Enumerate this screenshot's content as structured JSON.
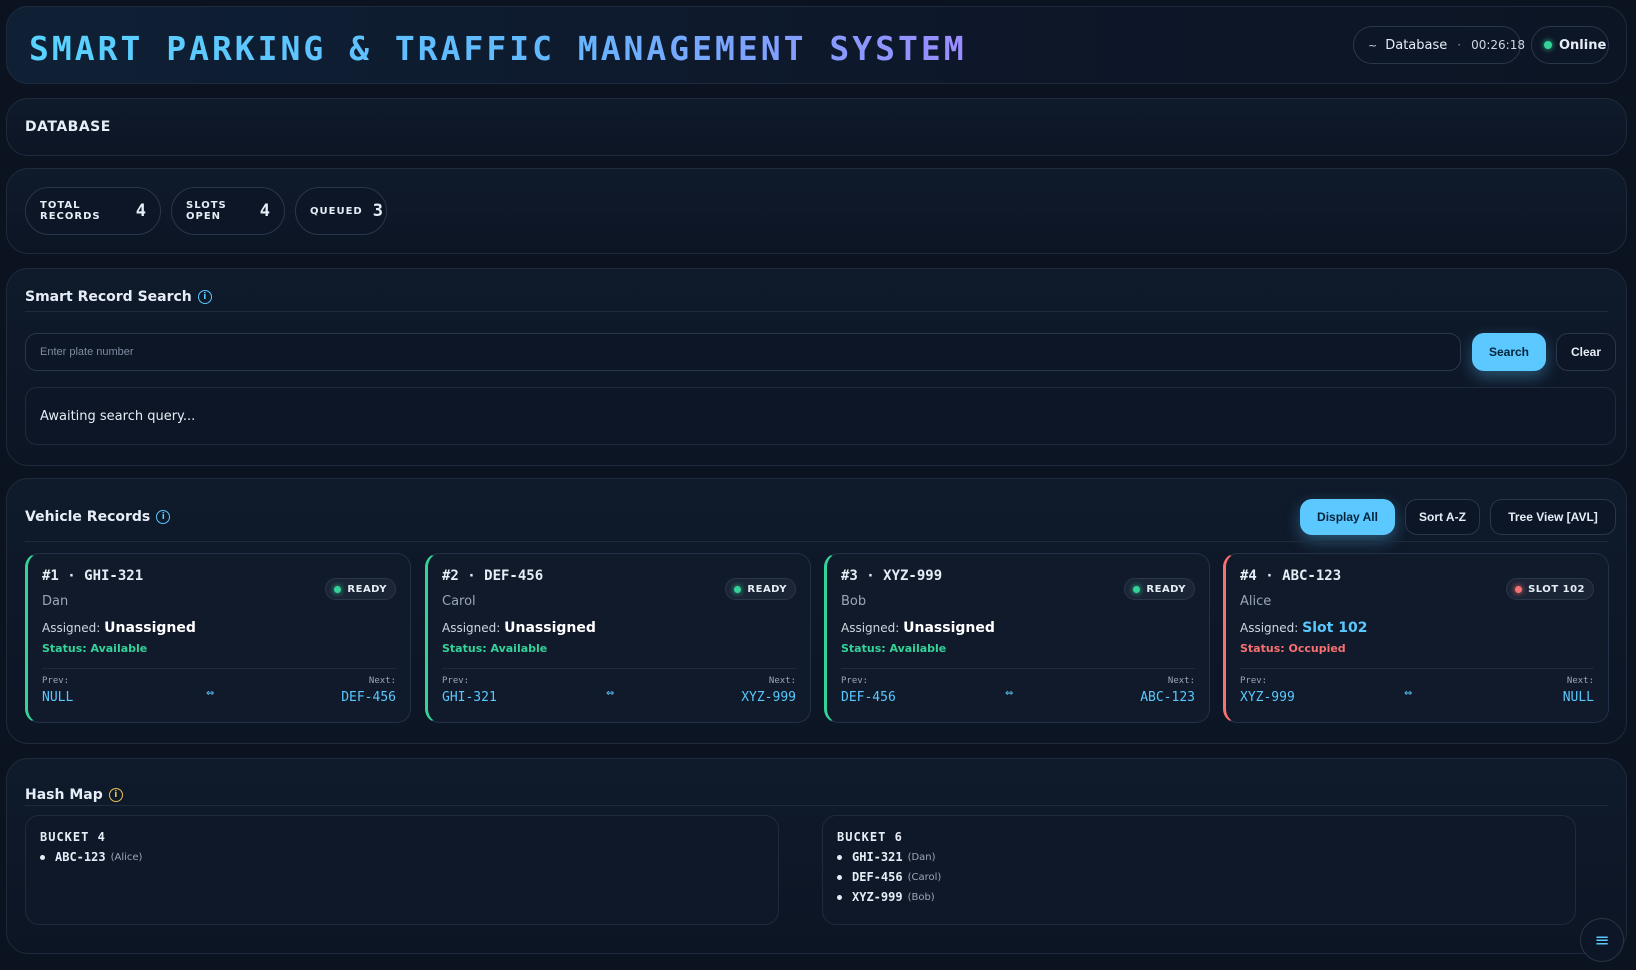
{
  "header": {
    "title": "SMART PARKING & TRAFFIC MANAGEMENT SYSTEM",
    "db_icon": "~",
    "db_label": "Database",
    "sep": "·",
    "time": "00:26:18",
    "status": "Online"
  },
  "database_label": "DATABASE",
  "stats": [
    {
      "label": "TOTAL RECORDS",
      "value": "4"
    },
    {
      "label": "SLOTS OPEN",
      "value": "4"
    },
    {
      "label": "QUEUED",
      "value": "3"
    }
  ],
  "search": {
    "title": "Smart Record Search",
    "placeholder": "Enter plate number",
    "search_label": "Search",
    "clear_label": "Clear",
    "result": "Awaiting search query..."
  },
  "records": {
    "title": "Vehicle Records",
    "display_all": "Display All",
    "sort": "Sort A-Z",
    "tree": "Tree View [AVL]",
    "assigned_prefix": "Assigned:",
    "prev_label": "Prev:",
    "next_label": "Next:",
    "arrow": "⇔",
    "cards": [
      {
        "id": "#1 · GHI-321",
        "owner": "Dan",
        "assigned": "Unassigned",
        "status": "Status: Available",
        "badge": "READY",
        "prev": "NULL",
        "next": "DEF-456"
      },
      {
        "id": "#2 · DEF-456",
        "owner": "Carol",
        "assigned": "Unassigned",
        "status": "Status: Available",
        "badge": "READY",
        "prev": "GHI-321",
        "next": "XYZ-999"
      },
      {
        "id": "#3 · XYZ-999",
        "owner": "Bob",
        "assigned": "Unassigned",
        "status": "Status: Available",
        "badge": "READY",
        "prev": "DEF-456",
        "next": "ABC-123"
      },
      {
        "id": "#4 · ABC-123",
        "owner": "Alice",
        "assigned": "Slot 102",
        "status": "Status: Occupied",
        "badge": "SLOT 102",
        "prev": "XYZ-999",
        "next": "NULL"
      }
    ]
  },
  "hash_map": {
    "title": "Hash Map",
    "buckets": [
      {
        "title": "BUCKET 4",
        "items": [
          {
            "plate": "ABC-123",
            "owner": "(Alice)"
          }
        ]
      },
      {
        "title": "BUCKET 6",
        "items": [
          {
            "plate": "GHI-321",
            "owner": "(Dan)"
          },
          {
            "plate": "DEF-456",
            "owner": "(Carol)"
          },
          {
            "plate": "XYZ-999",
            "owner": "(Bob)"
          }
        ]
      }
    ]
  },
  "menu_icon": "≡",
  "colors": {
    "accent": "#5bc8ff",
    "available": "#34d399",
    "occupied": "#f87171"
  }
}
